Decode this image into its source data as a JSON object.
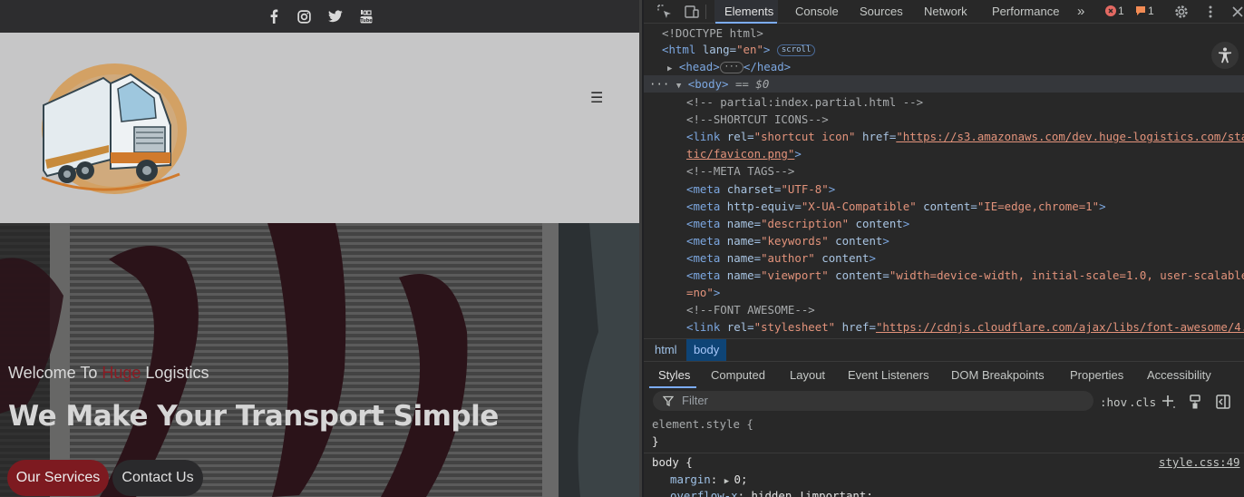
{
  "website": {
    "social_icons": [
      "facebook-icon",
      "instagram-icon",
      "twitter-icon",
      "youtube-icon"
    ],
    "menu_icon": "☰",
    "welcome_prefix": "Welcome To ",
    "welcome_brand": "Huge",
    "welcome_suffix": " Logistics",
    "hero_title": "We Make Your Transport Simple",
    "btn_services": "Our Services",
    "btn_contact": "Contact Us",
    "colors": {
      "brand": "#8c1a22",
      "header_bg": "#c6c6c7",
      "social_bar": "#2d2d2f"
    }
  },
  "devtools": {
    "tabs": [
      "Elements",
      "Console",
      "Sources",
      "Network",
      "Performance"
    ],
    "more_tabs": "»",
    "error_count": "1",
    "warning_count": "1",
    "dom": {
      "doctype": "<!DOCTYPE html>",
      "html_open_tag": "<html",
      "html_lang_attr": " lang=",
      "html_lang_val": "\"en\"",
      "html_close_bracket": ">",
      "scroll_badge": "scroll",
      "head_open": "<head>",
      "head_ellipsis": "···",
      "head_close": "</head>",
      "body_dots": "···",
      "body_tag": "<body>",
      "body_eq": " == $0",
      "lines": [
        {
          "t": "comment",
          "text": "<!-- partial:index.partial.html -->"
        },
        {
          "t": "comment",
          "text": "<!--SHORTCUT ICONS-->"
        },
        {
          "t": "el",
          "tag": "<link",
          "attrs": [
            [
              "rel",
              "\"shortcut icon\""
            ],
            [
              "href",
              "\"https://s3.amazonaws.com/dev.huge-logistics.com/sta"
            ]
          ],
          "link_attr": 1
        },
        {
          "t": "cont",
          "text": "tic/favicon.png\"",
          "after": ">"
        },
        {
          "t": "comment",
          "text": "<!--META TAGS-->"
        },
        {
          "t": "el",
          "tag": "<meta",
          "attrs": [
            [
              "charset",
              "\"UTF-8\""
            ]
          ],
          "close": ">"
        },
        {
          "t": "el",
          "tag": "<meta",
          "attrs": [
            [
              "http-equiv",
              "\"X-UA-Compatible\""
            ],
            [
              "content",
              "\"IE=edge,chrome=1\""
            ]
          ],
          "close": ">"
        },
        {
          "t": "el",
          "tag": "<meta",
          "attrs": [
            [
              "name",
              "\"description\""
            ],
            [
              "content",
              ""
            ]
          ],
          "close": ">"
        },
        {
          "t": "el",
          "tag": "<meta",
          "attrs": [
            [
              "name",
              "\"keywords\""
            ],
            [
              "content",
              ""
            ]
          ],
          "close": ">"
        },
        {
          "t": "el",
          "tag": "<meta",
          "attrs": [
            [
              "name",
              "\"author\""
            ],
            [
              "content",
              ""
            ]
          ],
          "close": ">"
        },
        {
          "t": "el",
          "tag": "<meta",
          "attrs": [
            [
              "name",
              "\"viewport\""
            ],
            [
              "content",
              "\"width=device-width, initial-scale=1.0, user-scalable"
            ]
          ]
        },
        {
          "t": "cont2",
          "text": "=no\"",
          "after": ">"
        },
        {
          "t": "comment",
          "text": "<!--FONT AWESOME-->"
        },
        {
          "t": "el",
          "tag": "<link",
          "attrs": [
            [
              "rel",
              "\"stylesheet\""
            ],
            [
              "href",
              "\"https://cdnjs.cloudflare.com/ajax/libs/font-awesome/4."
            ]
          ],
          "link_attr": 1
        }
      ]
    },
    "breadcrumb": [
      "html",
      "body"
    ],
    "styles_tabs": [
      "Styles",
      "Computed",
      "Layout",
      "Event Listeners",
      "DOM Breakpoints",
      "Properties",
      "Accessibility"
    ],
    "filter_placeholder": "Filter",
    "hov": ":hov",
    "cls": ".cls",
    "rules": {
      "element_style_open": "element.style {",
      "element_style_close": "}",
      "body_selector": "body {",
      "body_source": "style.css:49",
      "margin_prop": "margin",
      "margin_val": "0;",
      "overflow_prop": "overflow-x",
      "overflow_val": "hidden !important;"
    }
  }
}
